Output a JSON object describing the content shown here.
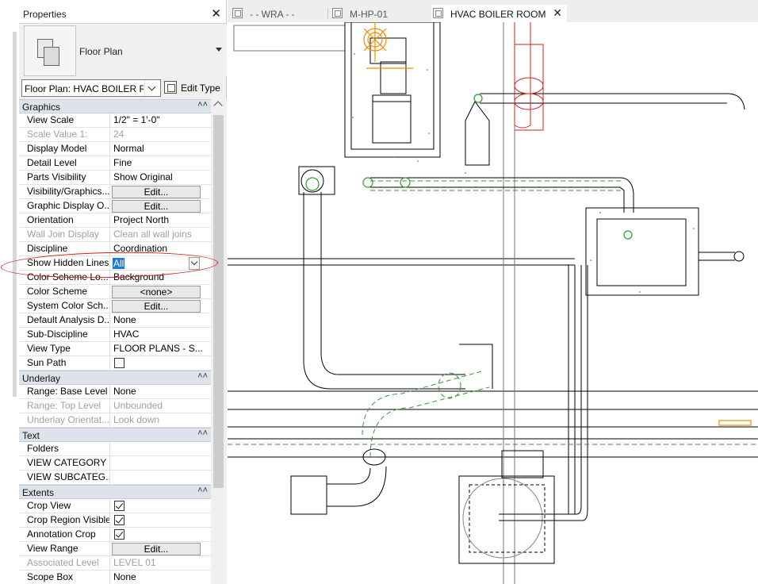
{
  "properties_panel": {
    "title": "Properties",
    "close_glyph": "✕",
    "type_selector": {
      "name": "Floor Plan"
    },
    "instance_selector": {
      "value": "Floor Plan: HVAC BOILER ROOM"
    },
    "edit_type_label": "Edit Type",
    "sections": [
      {
        "name": "Graphics",
        "rows": [
          {
            "name": "View Scale",
            "value": "1/2\" = 1'-0\"",
            "kind": "text"
          },
          {
            "name": "Scale Value    1:",
            "value": "24",
            "kind": "text",
            "dim": true
          },
          {
            "name": "Display Model",
            "value": "Normal",
            "kind": "text"
          },
          {
            "name": "Detail Level",
            "value": "Fine",
            "kind": "text"
          },
          {
            "name": "Parts Visibility",
            "value": "Show Original",
            "kind": "text"
          },
          {
            "name": "Visibility/Graphics...",
            "value": "Edit...",
            "kind": "button"
          },
          {
            "name": "Graphic Display O...",
            "value": "Edit...",
            "kind": "button"
          },
          {
            "name": "Orientation",
            "value": "Project North",
            "kind": "text"
          },
          {
            "name": "Wall Join Display",
            "value": "Clean all wall joins",
            "kind": "text",
            "dim": true
          },
          {
            "name": "Discipline",
            "value": "Coordination",
            "kind": "text"
          },
          {
            "name": "Show Hidden Lines",
            "value": "All",
            "kind": "select"
          },
          {
            "name": "Color Scheme Lo...",
            "value": "Background",
            "kind": "text"
          },
          {
            "name": "Color Scheme",
            "value": "<none>",
            "kind": "button"
          },
          {
            "name": "System Color Sch...",
            "value": "Edit...",
            "kind": "button"
          },
          {
            "name": "Default Analysis D...",
            "value": "None",
            "kind": "text"
          },
          {
            "name": "Sub-Discipline",
            "value": "HVAC",
            "kind": "text"
          },
          {
            "name": "View Type",
            "value": "FLOOR PLANS - S...",
            "kind": "text"
          },
          {
            "name": "Sun Path",
            "value": "",
            "kind": "checkbox",
            "checked": false
          }
        ]
      },
      {
        "name": "Underlay",
        "rows": [
          {
            "name": "Range: Base Level",
            "value": "None",
            "kind": "text"
          },
          {
            "name": "Range: Top Level",
            "value": "Unbounded",
            "kind": "text",
            "dim": true
          },
          {
            "name": "Underlay Orientat...",
            "value": "Look down",
            "kind": "text",
            "dim": true
          }
        ]
      },
      {
        "name": "Text",
        "rows": [
          {
            "name": "Folders",
            "value": "",
            "kind": "text"
          },
          {
            "name": "VIEW CATEGORY",
            "value": "",
            "kind": "text"
          },
          {
            "name": "VIEW SUBCATEG...",
            "value": "",
            "kind": "text"
          }
        ]
      },
      {
        "name": "Extents",
        "rows": [
          {
            "name": "Crop View",
            "value": "",
            "kind": "checkbox",
            "checked": true
          },
          {
            "name": "Crop Region Visible",
            "value": "",
            "kind": "checkbox",
            "checked": true
          },
          {
            "name": "Annotation Crop",
            "value": "",
            "kind": "checkbox",
            "checked": true
          },
          {
            "name": "View Range",
            "value": "Edit...",
            "kind": "button"
          },
          {
            "name": "Associated Level",
            "value": "LEVEL 01",
            "kind": "text",
            "dim": true
          },
          {
            "name": "Scope Box",
            "value": "None",
            "kind": "text"
          }
        ]
      }
    ]
  },
  "tabs": [
    {
      "label": "- - WRA - -",
      "active": false
    },
    {
      "label": "M-HP-01",
      "active": false
    },
    {
      "label": "HVAC BOILER ROOM",
      "active": true
    }
  ],
  "tab_close_glyph": "✕",
  "colors": {
    "annotation_red": "#d0211c",
    "selection_blue": "#1e78d7",
    "section_header": "#dde3ea",
    "pipe_green": "#2e9a2e",
    "highlight_orange": "#f08c00"
  },
  "canvas": {
    "icons": [
      "floor-plan-view-icon",
      "boiler-equipment",
      "pipe-fittings"
    ]
  }
}
